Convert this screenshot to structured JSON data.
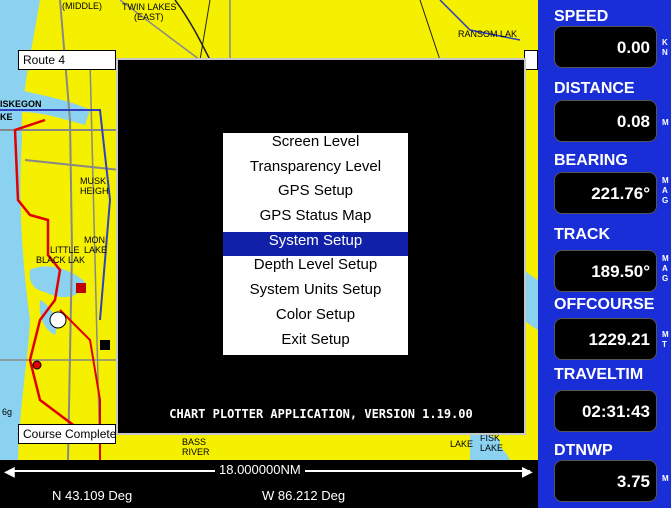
{
  "map": {
    "labels": {
      "middle": "(MIDDLE)",
      "twin_lakes": "TWIN LAKES",
      "east": "(EAST)",
      "ransom_lake": "RANSOM LAK",
      "muskegon": "ISKEGON",
      "ke": "KE",
      "musk": "MUSK",
      "heigh": "HEIGH",
      "mon": "MON",
      "lake": "LAKE",
      "little": "LITTLE",
      "black_lake": "BLACK LAK",
      "bass": "BASS",
      "river": "RIVER",
      "lake2": "LAKE",
      "fisk": "FISK",
      "fisk_lake": "LAKE",
      "depth": "6g"
    },
    "route_label": "Route 4",
    "course_label": "Course Complete"
  },
  "dialog": {
    "menu": [
      {
        "label": "Screen Level",
        "selected": false
      },
      {
        "label": "Transparency Level",
        "selected": false
      },
      {
        "label": "GPS Setup",
        "selected": false
      },
      {
        "label": "GPS Status Map",
        "selected": false
      },
      {
        "label": "System Setup",
        "selected": true
      },
      {
        "label": "Depth Level Setup",
        "selected": false
      },
      {
        "label": "System Units Setup",
        "selected": false
      },
      {
        "label": "Color Setup",
        "selected": false
      },
      {
        "label": "Exit Setup",
        "selected": false
      }
    ],
    "version": "CHART PLOTTER APPLICATION, VERSION 1.19.00"
  },
  "scale": {
    "label": "18.000000NM"
  },
  "coords": {
    "lat": "N 43.109 Deg",
    "lon": "W 86.212 Deg"
  },
  "panel": {
    "speed": {
      "label": "SPEED",
      "value": "0.00",
      "unit": "K\nN"
    },
    "distance": {
      "label": "DISTANCE",
      "value": "0.08",
      "unit": "M"
    },
    "bearing": {
      "label": "BEARING",
      "value": "221.76°",
      "unit": "M\nA\nG"
    },
    "track": {
      "label": "TRACK",
      "value": "189.50°",
      "unit": "M\nA\nG"
    },
    "offcourse": {
      "label": "OFFCOURSE",
      "value": "1229.21",
      "unit": "M\nT"
    },
    "traveltime": {
      "label": "TRAVELTIM",
      "value": "02:31:43",
      "unit": ""
    },
    "dtnwp": {
      "label": "DTNWP",
      "value": "3.75",
      "unit": "M"
    }
  },
  "colors": {
    "land": "#f5f000",
    "water": "#8ad2f0",
    "panel": "#1a2ed8",
    "selected": "#1020a8",
    "route": "#e00000"
  }
}
